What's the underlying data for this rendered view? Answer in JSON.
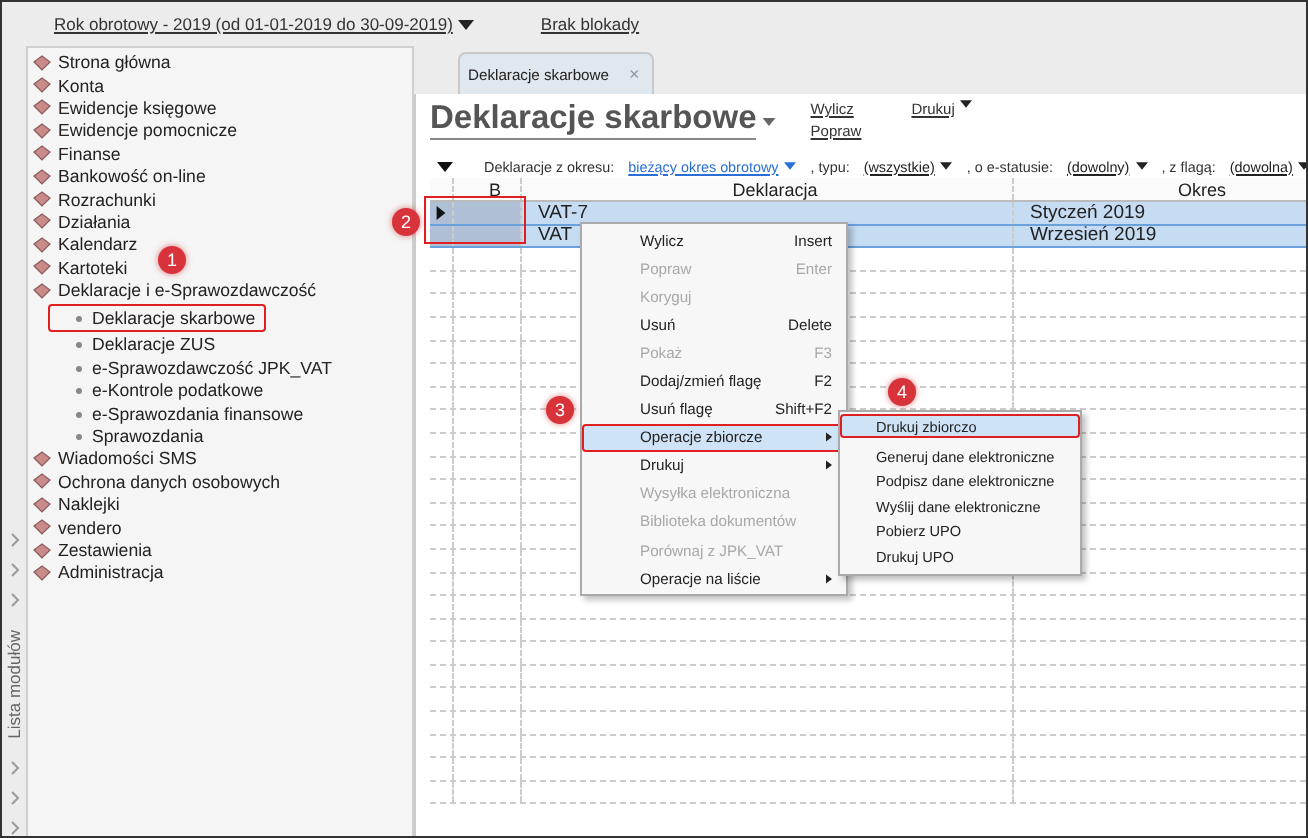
{
  "top_bar": {
    "fiscal_year": "Rok obrotowy - 2019  (od 01-01-2019 do 30-09-2019)",
    "lock_status": "Brak blokady"
  },
  "side_strip": {
    "label": "Lista modułów"
  },
  "sidebar": {
    "items": [
      {
        "label": "Strona główna",
        "annotated": false
      },
      {
        "label": "Konta",
        "annotated": false
      },
      {
        "label": "Ewidencje księgowe",
        "annotated": false
      },
      {
        "label": "Ewidencje pomocnicze",
        "annotated": false
      },
      {
        "label": "Finanse",
        "annotated": false
      },
      {
        "label": "Bankowość on-line",
        "annotated": false
      },
      {
        "label": "Rozrachunki",
        "annotated": false
      },
      {
        "label": "Działania",
        "annotated": false
      },
      {
        "label": "Kalendarz",
        "annotated": false
      },
      {
        "label": "Kartoteki",
        "annotated": false
      },
      {
        "label": "Deklaracje i e-Sprawozdawczość",
        "annotated": false,
        "children": [
          {
            "label": "Deklaracje skarbowe",
            "annotated": true
          },
          {
            "label": "Deklaracje ZUS",
            "annotated": false
          },
          {
            "label": "e-Sprawozdawczość JPK_VAT",
            "annotated": false
          },
          {
            "label": "e-Kontrole podatkowe",
            "annotated": false
          },
          {
            "label": "e-Sprawozdania finansowe",
            "annotated": false
          },
          {
            "label": "Sprawozdania",
            "annotated": false
          }
        ]
      },
      {
        "label": "Wiadomości SMS",
        "annotated": false
      },
      {
        "label": "Ochrona danych osobowych",
        "annotated": false
      },
      {
        "label": "Naklejki",
        "annotated": false
      },
      {
        "label": "vendero",
        "annotated": false
      },
      {
        "label": "Zestawienia",
        "annotated": false
      },
      {
        "label": "Administracja",
        "annotated": false
      }
    ]
  },
  "tab": {
    "label": "Deklaracje skarbowe",
    "close": "×"
  },
  "page_title": "Deklaracje skarbowe",
  "actions": [
    {
      "label": "Wylicz"
    },
    {
      "label": "Popraw"
    }
  ],
  "print_menu": "Drukuj",
  "filters": [
    {
      "label": "Deklaracje z okresu:",
      "value": "bieżący okres obrotowy",
      "link": true
    },
    {
      "label": ", typu:",
      "value": "(wszystkie)",
      "link": false
    },
    {
      "label": ", o e-statusie:",
      "value": "(dowolny)",
      "link": false
    },
    {
      "label": ", z flagą:",
      "value": "(dowolna)",
      "link": false
    }
  ],
  "table": {
    "columns": [
      "B",
      "Deklaracja",
      "Okres"
    ],
    "rows": [
      {
        "current": true,
        "selected": true,
        "cells": [
          "VAT-7",
          "Styczeń 2019"
        ]
      },
      {
        "current": false,
        "selected": true,
        "cells": [
          "VAT",
          "Wrzesień 2019"
        ]
      }
    ]
  },
  "context_menu": {
    "items": [
      {
        "label": "Wylicz",
        "shortcut": "Insert",
        "disabled": false,
        "submenu": false,
        "selected": false
      },
      {
        "label": "Popraw",
        "shortcut": "Enter",
        "disabled": true,
        "submenu": false,
        "selected": false
      },
      {
        "label": "Koryguj",
        "disabled": true,
        "submenu": false,
        "selected": false
      },
      {
        "label": "Usuń",
        "shortcut": "Delete",
        "disabled": false,
        "submenu": false,
        "selected": false
      },
      {
        "label": "Pokaż",
        "shortcut": "F3",
        "disabled": true,
        "submenu": false,
        "selected": false
      },
      {
        "label": "Dodaj/zmień flagę",
        "shortcut": "F2",
        "disabled": false,
        "submenu": false,
        "selected": false
      },
      {
        "label": "Usuń flagę",
        "shortcut": "Shift+F2",
        "disabled": false,
        "submenu": false,
        "selected": false
      },
      {
        "label": "Operacje zbiorcze",
        "disabled": false,
        "submenu": true,
        "selected": true
      },
      {
        "label": "Drukuj",
        "disabled": false,
        "submenu": true,
        "selected": false
      },
      {
        "label": "Wysyłka elektroniczna",
        "disabled": true,
        "submenu": false,
        "selected": false
      },
      {
        "label": "Biblioteka dokumentów",
        "disabled": true,
        "submenu": false,
        "selected": false
      },
      {
        "label": "Porównaj z JPK_VAT",
        "disabled": true,
        "submenu": false,
        "selected": false
      },
      {
        "label": "Operacje na liście",
        "disabled": false,
        "submenu": true,
        "selected": false
      }
    ]
  },
  "submenu": {
    "items": [
      {
        "label": "Drukuj zbiorczo",
        "selected": true
      },
      {
        "label": "Generuj dane elektroniczne",
        "selected": false
      },
      {
        "label": "Podpisz dane elektroniczne",
        "selected": false
      },
      {
        "label": "Wyślij dane elektroniczne",
        "selected": false
      },
      {
        "label": "Pobierz UPO",
        "selected": false
      },
      {
        "label": "Drukuj UPO",
        "selected": false
      }
    ]
  },
  "callouts": [
    "1",
    "2",
    "3",
    "4"
  ]
}
